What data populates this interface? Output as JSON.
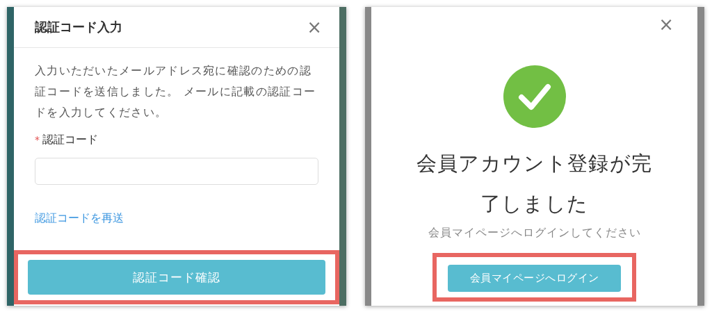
{
  "verify_dialog": {
    "title": "認証コード入力",
    "close": "×",
    "message": "入力いただいたメールアドレス宛に確認のための認証コードを送信しました。 メールに記載の認証コードを入力してください。",
    "field": {
      "label": "認証コード",
      "required": true,
      "required_mark": "*"
    },
    "resend_link": "認証コードを再送",
    "confirm_button": {
      "label": "認証コード確認",
      "highlighted": true
    }
  },
  "complete_dialog": {
    "close": "×",
    "heading": "会員アカウント登録が完了しました",
    "subtext": "会員マイページへログインしてください",
    "login_button": {
      "label": "会員マイページへログイン",
      "highlighted": true
    }
  }
}
